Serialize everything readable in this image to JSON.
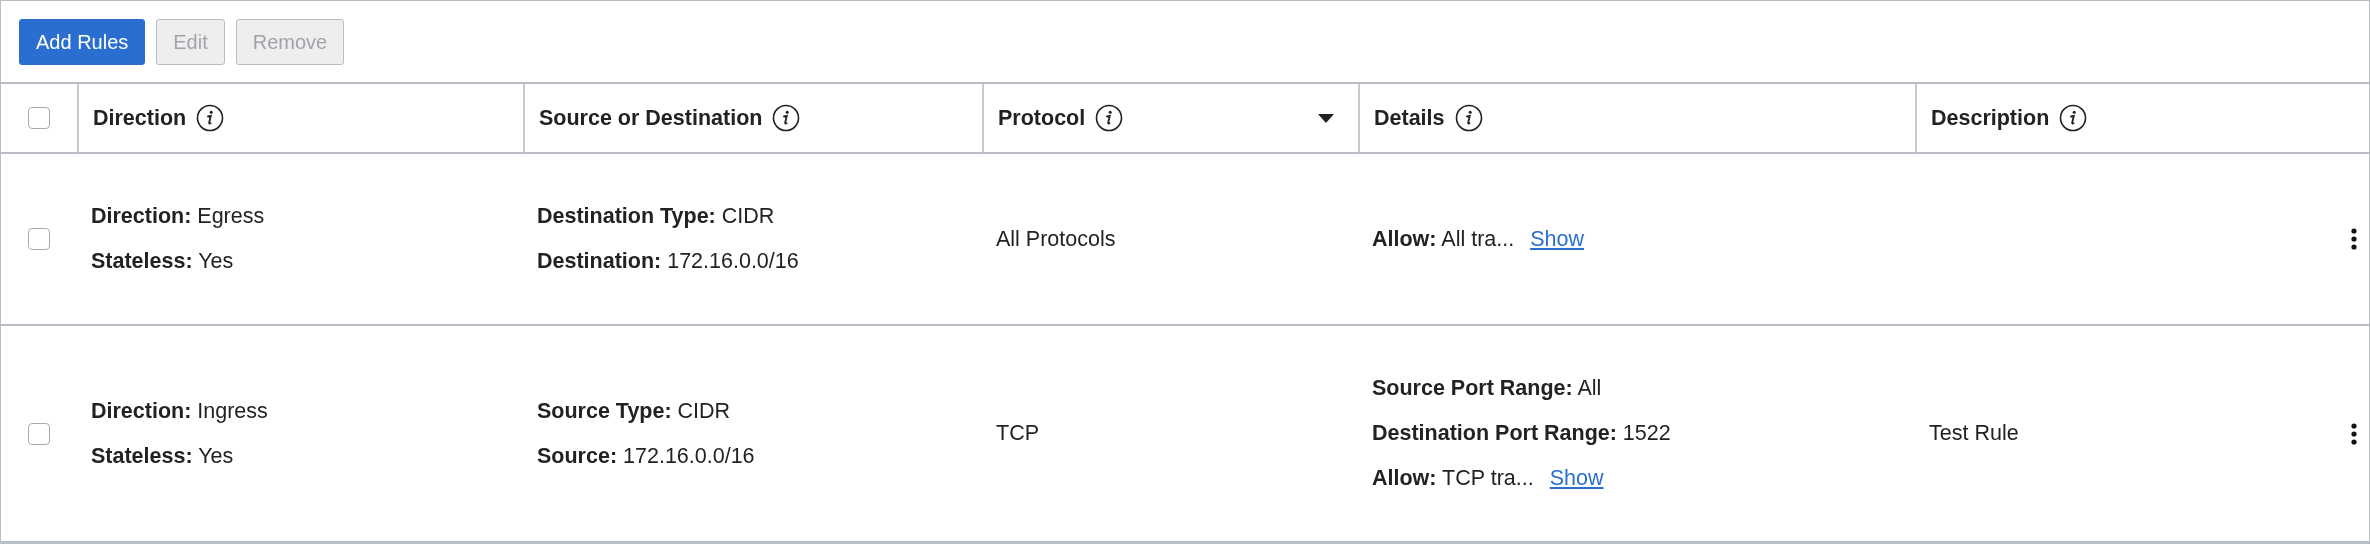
{
  "toolbar": {
    "buttons": [
      {
        "label": "Add Rules",
        "disabled": false
      },
      {
        "label": "Edit",
        "disabled": true
      },
      {
        "label": "Remove",
        "disabled": true
      }
    ]
  },
  "table": {
    "select_all": {
      "selected": false
    },
    "columns": [
      {
        "label": "Direction",
        "menu": false
      },
      {
        "label": "Source or Destination",
        "menu": false
      },
      {
        "label": "Protocol",
        "menu": true
      },
      {
        "label": "Details",
        "menu": false
      },
      {
        "label": "Description",
        "menu": false
      }
    ],
    "rows": [
      {
        "selected": false,
        "direction": [
          {
            "label": "Direction:",
            "value": "Egress"
          },
          {
            "label": "Stateless:",
            "value": "Yes"
          }
        ],
        "source": [
          {
            "label": "Destination Type:",
            "value": "CIDR"
          },
          {
            "label": "Destination:",
            "value": "172.16.0.0/16"
          }
        ],
        "protocol": "All Protocols",
        "details": [
          {
            "label": "Allow:",
            "value": "All tra...",
            "link": "Show"
          }
        ]
      },
      {
        "selected": false,
        "direction": [
          {
            "label": "Direction:",
            "value": "Ingress"
          },
          {
            "label": "Stateless:",
            "value": "Yes"
          }
        ],
        "source": [
          {
            "label": "Source Type:",
            "value": "CIDR"
          },
          {
            "label": "Source:",
            "value": "172.16.0.0/16"
          }
        ],
        "protocol": "TCP",
        "details": [
          {
            "label": "Source Port Range:",
            "value": "All"
          },
          {
            "label": "Destination Port Range:",
            "value": "1522"
          },
          {
            "label": "Allow:",
            "value": "TCP tra...",
            "link": "Show"
          }
        ],
        "description": "Test Rule"
      }
    ]
  }
}
